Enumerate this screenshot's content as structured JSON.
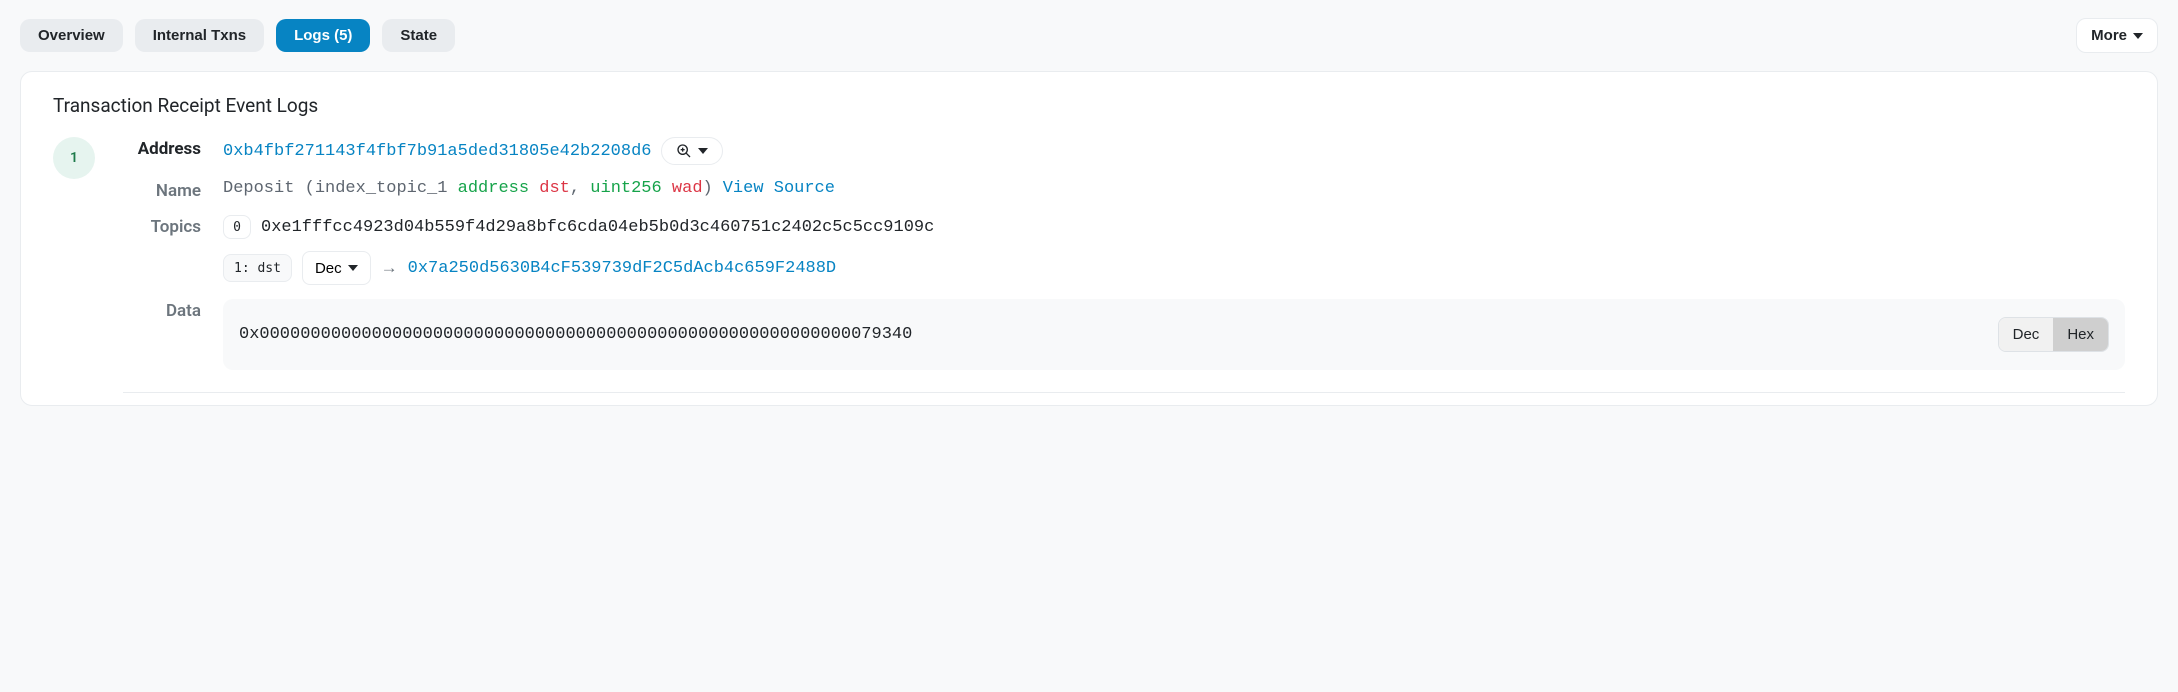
{
  "tabs": {
    "overview": "Overview",
    "internal": "Internal Txns",
    "logs": "Logs (5)",
    "state": "State"
  },
  "more": "More",
  "panel": {
    "title": "Transaction Receipt Event Logs"
  },
  "log": {
    "index": "1",
    "labels": {
      "address": "Address",
      "name": "Name",
      "topics": "Topics",
      "data": "Data"
    },
    "address": "0xb4fbf271143f4fbf7b91a5ded31805e42b2208d6",
    "name": {
      "func": "Deposit",
      "open": " (",
      "idx": "index_topic_1 ",
      "type1": "address",
      "param1": " dst",
      "sep": ", ",
      "type2": "uint256",
      "param2": " wad",
      "close": ")",
      "view_source": "View Source"
    },
    "topics": {
      "t0_idx": "0",
      "t0_val": "0xe1fffcc4923d04b559f4d29a8bfc6cda04eb5b0d3c460751c2402c5c5cc9109c",
      "t1_label": "1: dst",
      "t1_fmt": "Dec",
      "t1_arrow": "→",
      "t1_val": "0x7a250d5630B4cF539739dF2C5dAcb4c659F2488D"
    },
    "data": {
      "value": "0x0000000000000000000000000000000000000000000000000000000000079340",
      "dec": "Dec",
      "hex": "Hex"
    }
  }
}
